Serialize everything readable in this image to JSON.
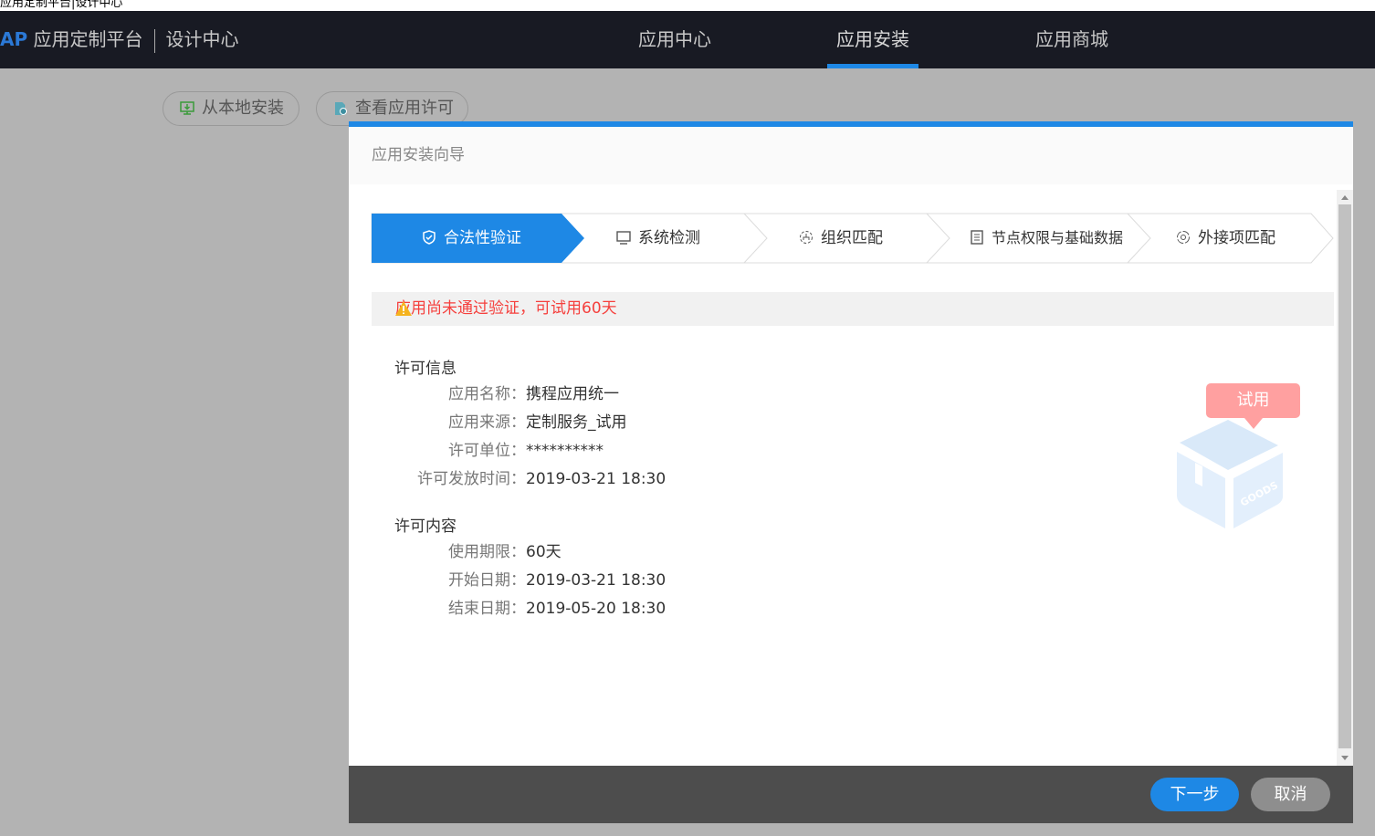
{
  "window_title": "应用定制平台|设计中心",
  "header": {
    "logo": "AP",
    "platform": "应用定制平台",
    "center": "设计中心",
    "nav": [
      {
        "label": "应用中心",
        "active": false
      },
      {
        "label": "应用安装",
        "active": true
      },
      {
        "label": "应用商城",
        "active": false
      }
    ]
  },
  "toolbar": {
    "install_local": "从本地安装",
    "view_license": "查看应用许可"
  },
  "modal": {
    "title": "应用安装向导",
    "steps": [
      {
        "label": "合法性验证",
        "icon": "shield-check-icon",
        "active": true
      },
      {
        "label": "系统检测",
        "icon": "monitor-icon"
      },
      {
        "label": "组织匹配",
        "icon": "org-icon"
      },
      {
        "label": "节点权限与基础数据",
        "icon": "list-doc-icon"
      },
      {
        "label": "外接项匹配",
        "icon": "plugin-icon"
      }
    ],
    "warning": "应用尚未通过验证，可试用60天",
    "license_info": {
      "title": "许可信息",
      "rows": [
        {
          "k": "应用名称：",
          "v": "携程应用统一"
        },
        {
          "k": "应用来源：",
          "v": "定制服务_试用"
        },
        {
          "k": "许可单位：",
          "v": "**********"
        },
        {
          "k": "许可发放时间：",
          "v": "2019-03-21 18:30"
        }
      ]
    },
    "license_content": {
      "title": "许可内容",
      "rows": [
        {
          "k": "使用期限：",
          "v": "60天"
        },
        {
          "k": "开始日期：",
          "v": "2019-03-21 18:30"
        },
        {
          "k": "结束日期：",
          "v": "2019-05-20 18:30"
        }
      ]
    },
    "badge": "试用",
    "box_label": "GOODS",
    "next": "下一步",
    "cancel": "取消"
  },
  "colors": {
    "accent": "#1e88e5",
    "warning": "#f5403d",
    "badge": "#ffa0a0",
    "topbar": "#181a23"
  }
}
